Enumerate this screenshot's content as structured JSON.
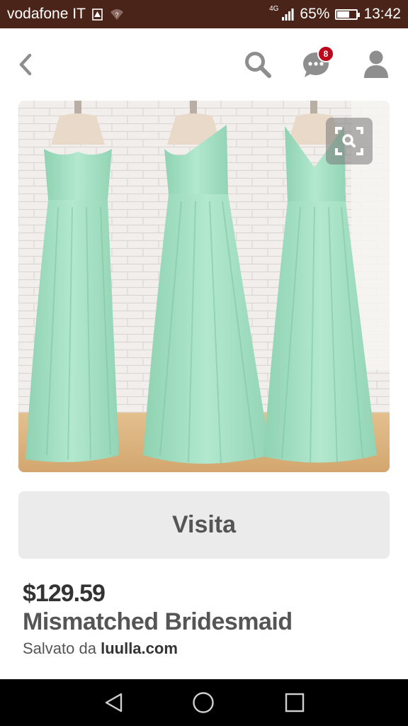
{
  "status_bar": {
    "carrier": "vodafone IT",
    "network": "4G",
    "battery_percent": "65%",
    "battery_level": 0.65,
    "time": "13:42",
    "background_color": "#4a2418"
  },
  "header": {
    "icons": [
      "back-icon",
      "search-icon",
      "chat-icon",
      "profile-icon"
    ],
    "notification_count": "8",
    "badge_color": "#bd081c",
    "icon_color": "#8e8e8e"
  },
  "pin": {
    "visit_label": "Visita",
    "price": "$129.59",
    "title": "Mismatched Bridesmaid",
    "saved_prefix": "Salvato da",
    "saved_source": "luulla.com",
    "dress_color": "#a8e2c6"
  },
  "nav_bar": {
    "icons": [
      "back-triangle-icon",
      "home-circle-icon",
      "recents-square-icon"
    ]
  }
}
